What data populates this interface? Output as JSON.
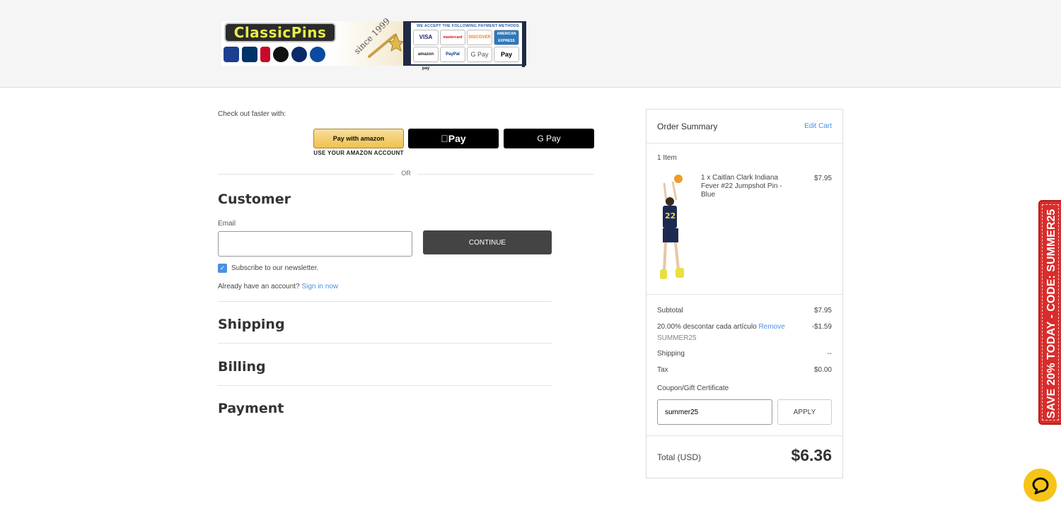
{
  "header": {
    "logo_text": "ClassicPins",
    "since_text": "since 1999",
    "payment_banner_title": "WE ACCEPT THE FOLLOWING PAYMENT METHODS",
    "payment_methods": [
      "VISA",
      "mastercard",
      "DISCOVER",
      "AMERICAN EXPRESS",
      "amazon pay",
      "PayPal",
      "G Pay",
      "Pay"
    ]
  },
  "express": {
    "checkout_faster": "Check out faster with:",
    "amazon_label": "Pay with amazon",
    "amazon_caption": "USE YOUR AMAZON ACCOUNT",
    "apple_label": "Pay",
    "google_label": "G Pay",
    "or_text": "OR"
  },
  "customer": {
    "title": "Customer",
    "email_label": "Email",
    "email_value": "",
    "continue_label": "CONTINUE",
    "newsletter_label": "Subscribe to our newsletter.",
    "newsletter_checked": true,
    "already_text": "Already have an account?",
    "signin_label": "Sign in now"
  },
  "sections": {
    "shipping": "Shipping",
    "billing": "Billing",
    "payment": "Payment"
  },
  "summary": {
    "title": "Order Summary",
    "edit_cart": "Edit Cart",
    "item_count": "1 Item",
    "item": {
      "name": "1 x Caitlan Clark Indiana Fever #22 Jumpshot Pin - Blue",
      "price": "$7.95"
    },
    "subtotal_label": "Subtotal",
    "subtotal_value": "$7.95",
    "discount_label": "20.00% descontar cada artículo",
    "discount_remove": "Remove",
    "discount_value": "-$1.59",
    "discount_code": "SUMMER25",
    "shipping_label": "Shipping",
    "shipping_value": "--",
    "tax_label": "Tax",
    "tax_value": "$0.00",
    "coupon_label": "Coupon/Gift Certificate",
    "coupon_value": "summer25",
    "apply_label": "APPLY",
    "total_label": "Total (USD)",
    "total_value": "$6.36"
  },
  "promo": {
    "text": "SAVE 20% TODAY - CODE: SUMMER25"
  },
  "colors": {
    "link": "#4a90e2",
    "dark_button": "#444444",
    "promo_red": "#d92c2c",
    "chat_yellow": "#f6c416"
  }
}
